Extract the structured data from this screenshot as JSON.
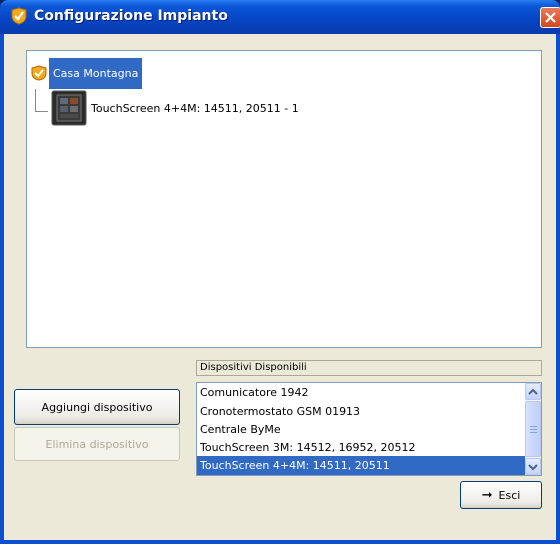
{
  "window": {
    "title": "Configurazione Impianto",
    "icon": "shield-check-icon",
    "close": "close-icon"
  },
  "tree": {
    "root": {
      "label": "Casa Montagna",
      "icon": "house-shield-icon"
    },
    "children": [
      {
        "label": "TouchScreen 4+4M: 14511, 20511 - 1",
        "icon": "touchscreen-device-icon"
      }
    ]
  },
  "actions": {
    "add_label": "Aggiungi dispositivo",
    "delete_label": "Elimina dispositivo"
  },
  "available": {
    "header": "Dispositivi Disponibili",
    "items": [
      "Comunicatore 1942",
      "Cronotermostato GSM 01913",
      "Centrale ByMe",
      "TouchScreen 3M: 14512, 16952, 20512",
      "TouchScreen 4+4M: 14511, 20511"
    ],
    "selected_index": 4
  },
  "footer": {
    "exit_label": "Esci",
    "exit_icon": "arrow-right-icon"
  },
  "colors": {
    "titlebar": "#0646c6",
    "selection": "#316ac5",
    "background": "#ece9d8"
  }
}
